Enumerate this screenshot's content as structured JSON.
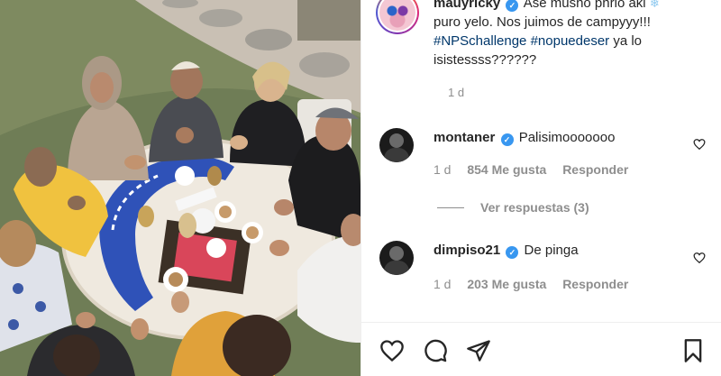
{
  "post": {
    "username": "mauyricky",
    "caption_text": " Ase musho phrio aki",
    "caption_text2": " puro yelo. Nos juimos de campyyy!!!",
    "hashtags": [
      "#NPSchallenge",
      "#nopuedeser"
    ],
    "caption_tail": " ya lo isistessss??????",
    "snow_emoji": "❄",
    "verified_mark": "✓",
    "time": "1 d"
  },
  "comments": [
    {
      "username": "montaner",
      "text": "Palisimooooooo",
      "time": "1 d",
      "likes": "854 Me gusta",
      "reply_label": "Responder"
    },
    {
      "username": "dimpiso21",
      "text": "De pinga",
      "time": "1 d",
      "likes": "203 Me gusta",
      "reply_label": "Responder"
    }
  ],
  "view_replies": "Ver respuestas (3)",
  "icons": {
    "verified": "verified-badge-icon",
    "like": "heart-icon",
    "comment": "comment-icon",
    "share": "paper-plane-icon",
    "save": "bookmark-icon"
  },
  "colors": {
    "text": "#262626",
    "muted": "#8e8e8e",
    "link": "#00376b",
    "verified": "#3897f0"
  }
}
